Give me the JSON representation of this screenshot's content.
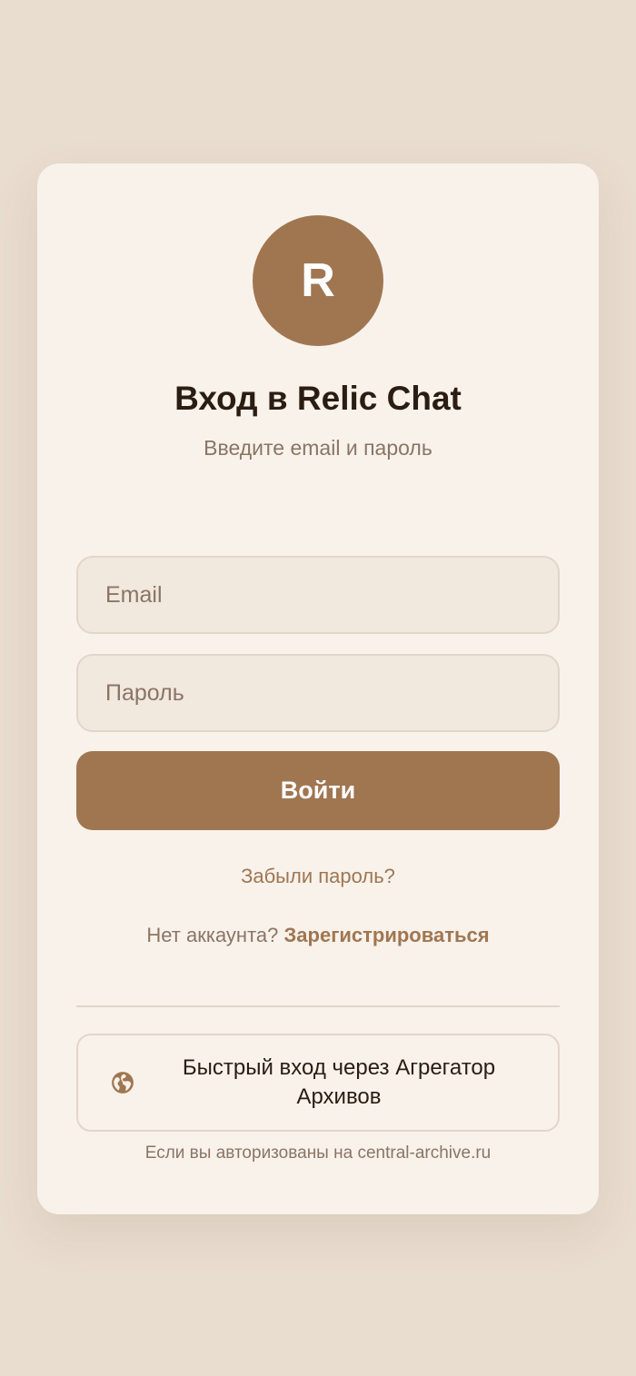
{
  "logo": {
    "letter": "R"
  },
  "header": {
    "title": "Вход в Relic Chat",
    "subtitle": "Введите email и пароль"
  },
  "form": {
    "email_placeholder": "Email",
    "password_placeholder": "Пароль",
    "submit_label": "Войти"
  },
  "links": {
    "forgot_password": "Забыли пароль?",
    "no_account_text": "Нет аккаунта?",
    "register": "Зарегистрироваться"
  },
  "aggregator": {
    "icon": "globe-icon",
    "label": "Быстрый вход через Агрегатор Архивов",
    "hint": "Если вы авторизованы на central-archive.ru"
  },
  "colors": {
    "background": "#e9ddd0",
    "card": "#f8f2eb",
    "accent": "#a07651",
    "text_primary": "#2b1d12",
    "text_secondary": "#8a7565"
  }
}
